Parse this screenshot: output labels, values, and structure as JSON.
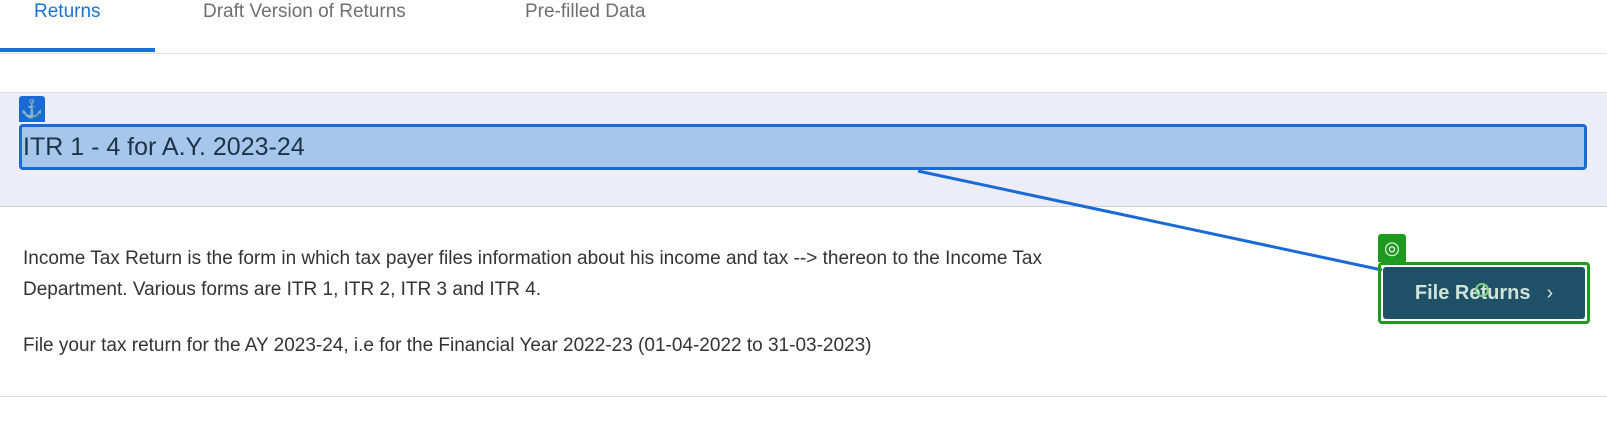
{
  "tabs": [
    {
      "label": "Returns",
      "active": true
    },
    {
      "label": "Draft Version of Returns",
      "active": false
    },
    {
      "label": "Pre-filled Data",
      "active": false
    }
  ],
  "section": {
    "title": "ITR 1 - 4 for A.Y. 2023-24"
  },
  "description": {
    "paragraph1": "Income Tax Return is the form in which tax payer files information about his income and tax --> thereon to the Income Tax Department. Various forms are ITR 1, ITR 2, ITR 3 and ITR 4.",
    "paragraph2": "File your tax return for the AY 2023-24, i.e for the Financial Year 2022-23 (01-04-2022 to 31-03-2023)"
  },
  "actions": {
    "file_returns_label": "File Returns",
    "file_returns_chevron": "›"
  },
  "overlay": {
    "anchor_icon": "⚓",
    "target_icon": "◎"
  },
  "colors": {
    "accent": "#1773d6",
    "button_bg": "#1e5068",
    "highlight_blue": "#1a6ad6",
    "highlight_green": "#1e9b1e"
  }
}
